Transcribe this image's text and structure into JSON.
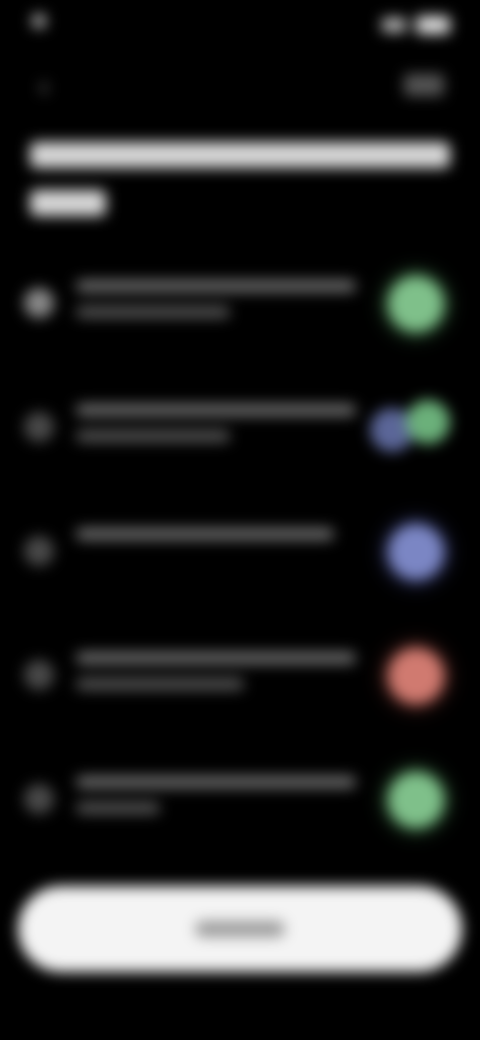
{
  "colors": {
    "background": "#000000",
    "green": "#7fc08a",
    "blue": "#7b86c4",
    "red": "#d07a70",
    "button": "#f4f4f4"
  },
  "icons": {
    "back": "arrow-left-icon",
    "row": "circle-icon"
  },
  "list": {
    "items": [
      {
        "badge": "green"
      },
      {
        "badge": "blue-green"
      },
      {
        "badge": "blue"
      },
      {
        "badge": "red"
      },
      {
        "badge": "green"
      }
    ]
  }
}
